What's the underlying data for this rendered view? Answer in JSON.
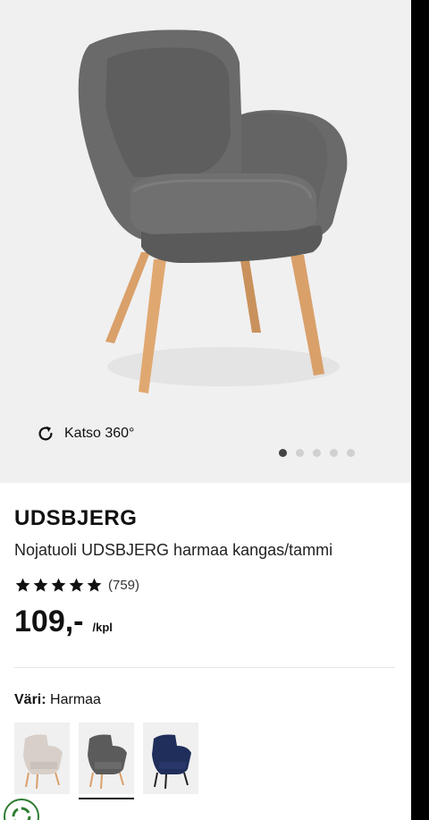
{
  "gallery": {
    "view360_label": "Katso 360°",
    "slide_count": 5,
    "active_slide": 1
  },
  "product": {
    "name": "UDSBJERG",
    "description": "Nojatuoli UDSBJERG harmaa kangas/tammi",
    "rating_stars": 5,
    "rating_count": "(759)",
    "price": "109,-",
    "price_unit": "/kpl"
  },
  "color": {
    "label": "Väri:",
    "value": "Harmaa",
    "swatches": [
      {
        "name": "beige",
        "hex": "#d8cfc9"
      },
      {
        "name": "harmaa",
        "hex": "#5b5b5b",
        "selected": true
      },
      {
        "name": "navy",
        "hex": "#1f2e5a"
      }
    ]
  },
  "colors": {
    "gallery_bg": "#f0f0f0",
    "chair_fabric": "#6a6a6a",
    "chair_legs": "#d9a06a",
    "rightbar": "#000000"
  }
}
